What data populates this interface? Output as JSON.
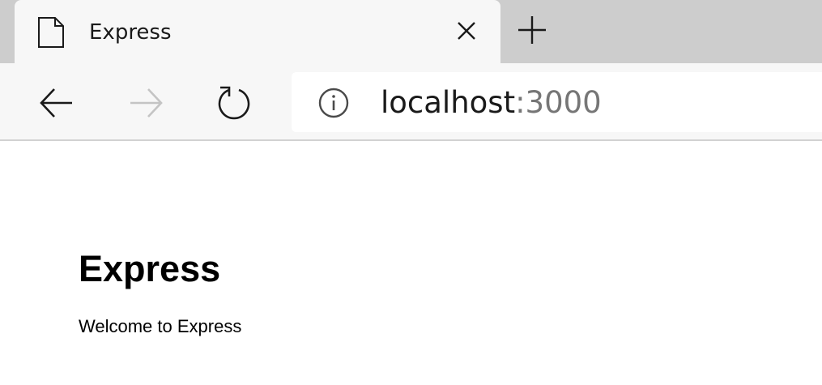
{
  "tab": {
    "title": "Express",
    "icon": "document-icon",
    "close_icon": "close-icon"
  },
  "new_tab_icon": "plus-icon",
  "toolbar": {
    "back_icon": "arrow-left-icon",
    "forward_icon": "arrow-right-icon",
    "forward_enabled": false,
    "refresh_icon": "refresh-icon"
  },
  "address_bar": {
    "info_icon": "info-icon",
    "host": "localhost",
    "port": ":3000"
  },
  "page": {
    "heading": "Express",
    "text": "Welcome to Express"
  },
  "colors": {
    "tab_strip": "#cdcdcd",
    "toolbar": "#f7f7f7",
    "icon": "#1a1a1a",
    "icon_disabled": "#c4c4c4",
    "url_port": "#767676"
  }
}
